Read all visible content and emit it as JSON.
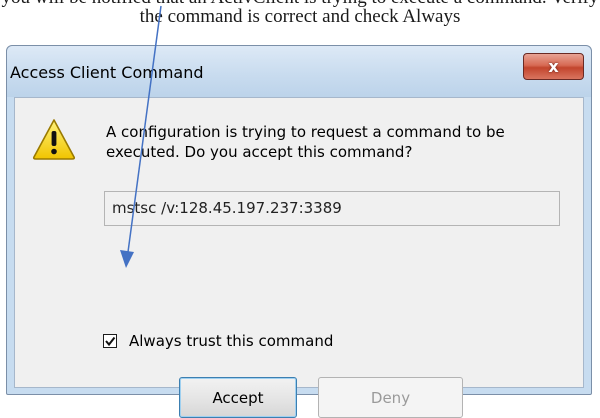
{
  "caption": "you will be notified that an ActivClient is trying to execute a command. Verify the command is correct and check Always",
  "dialog": {
    "title": "Access Client Command",
    "close_glyph": "x",
    "icon": "warning-icon",
    "message": "A configuration is trying to request a command to be executed. Do you accept this command?",
    "command_value": "mstsc /v:128.45.197.237:3389",
    "checkbox_label": "Always trust this command",
    "checkbox_checked": true,
    "accept_label": "Accept",
    "deny_label": "Deny"
  },
  "colors": {
    "annotation_arrow": "#4472c4",
    "close_button": "#c7432d",
    "warning_yellow": "#f5d000"
  }
}
